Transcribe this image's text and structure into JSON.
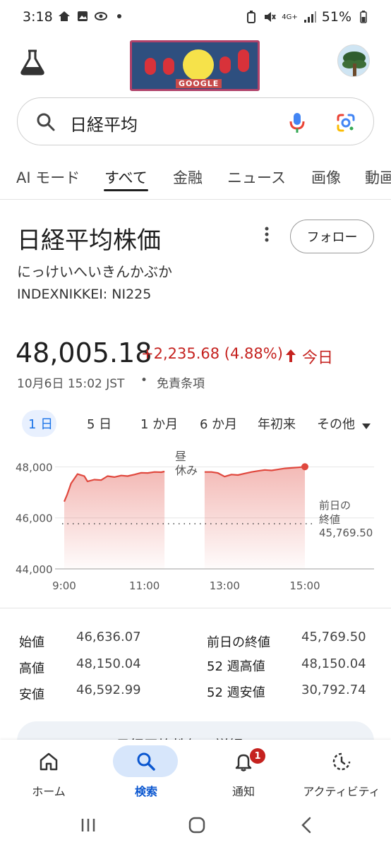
{
  "status": {
    "time": "3:18",
    "battery": "51%",
    "network": "4G+"
  },
  "header": {
    "doodle_word": "GOOGLE",
    "labs_icon": "flask-icon",
    "avatar_icon": "avatar"
  },
  "search": {
    "query": "日経平均"
  },
  "tabs": [
    {
      "label": "AI モード"
    },
    {
      "label": "すべて"
    },
    {
      "label": "金融"
    },
    {
      "label": "ニュース"
    },
    {
      "label": "画像"
    },
    {
      "label": "動画"
    }
  ],
  "stock": {
    "title": "日経平均株価",
    "reading": "にっけいへいきんかぶか",
    "ticker": "INDEXNIKKEI: NI225",
    "follow_label": "フォロー",
    "price": "48,005.18",
    "change": "+2,235.68 (4.88%)",
    "change_period": "今日",
    "timestamp": "10月6日 15:02 JST",
    "separator": "•",
    "disclaimer": "免責条項"
  },
  "ranges": [
    "1 日",
    "5 日",
    "1 か月",
    "6 か月",
    "年初来",
    "その他"
  ],
  "chart_data": {
    "type": "area",
    "y_ticks": [
      "48,000",
      "46,000",
      "44,000"
    ],
    "x_ticks": [
      "9:00",
      "11:00",
      "13:00",
      "15:00"
    ],
    "ylim": [
      44000,
      48400
    ],
    "lunch_label": [
      "昼",
      "休み"
    ],
    "prev_close_label": [
      "前日の",
      "終値"
    ],
    "prev_close_value": "45,769.50",
    "prev_close": 45769.5,
    "morning": [
      [
        9.0,
        46636
      ],
      [
        9.07,
        46900
      ],
      [
        9.17,
        47350
      ],
      [
        9.33,
        47720
      ],
      [
        9.5,
        47640
      ],
      [
        9.58,
        47430
      ],
      [
        9.75,
        47500
      ],
      [
        9.92,
        47480
      ],
      [
        10.08,
        47640
      ],
      [
        10.25,
        47600
      ],
      [
        10.42,
        47660
      ],
      [
        10.58,
        47640
      ],
      [
        10.75,
        47700
      ],
      [
        10.92,
        47770
      ],
      [
        11.08,
        47760
      ],
      [
        11.25,
        47800
      ],
      [
        11.42,
        47790
      ],
      [
        11.5,
        47820
      ]
    ],
    "afternoon": [
      [
        12.5,
        47800
      ],
      [
        12.67,
        47800
      ],
      [
        12.83,
        47760
      ],
      [
        13.0,
        47620
      ],
      [
        13.17,
        47700
      ],
      [
        13.33,
        47680
      ],
      [
        13.5,
        47740
      ],
      [
        13.67,
        47800
      ],
      [
        13.83,
        47840
      ],
      [
        14.0,
        47880
      ],
      [
        14.17,
        47860
      ],
      [
        14.33,
        47900
      ],
      [
        14.5,
        47940
      ],
      [
        14.67,
        47960
      ],
      [
        14.83,
        47980
      ],
      [
        15.0,
        48005
      ]
    ]
  },
  "stats": {
    "open_label": "始値",
    "open_value": "46,636.07",
    "high_label": "高値",
    "high_value": "48,150.04",
    "low_label": "安値",
    "low_value": "46,592.99",
    "prev_close_label": "前日の終値",
    "prev_close_value": "45,769.50",
    "week52_high_label": "52 週高値",
    "week52_high_value": "48,150.04",
    "week52_low_label": "52 週安値",
    "week52_low_value": "30,792.74"
  },
  "details_button": {
    "label": "日経平均株価の詳細"
  },
  "bottom_nav": [
    {
      "label": "ホーム",
      "icon": "home-icon"
    },
    {
      "label": "検索",
      "icon": "search-icon"
    },
    {
      "label": "通知",
      "icon": "bell-icon",
      "badge": "1"
    },
    {
      "label": "アクティビティ",
      "icon": "activity-icon"
    }
  ],
  "colors": {
    "accent": "#1a73e8",
    "negative_red": "#c5221f",
    "chart_line": "#e0483e"
  }
}
